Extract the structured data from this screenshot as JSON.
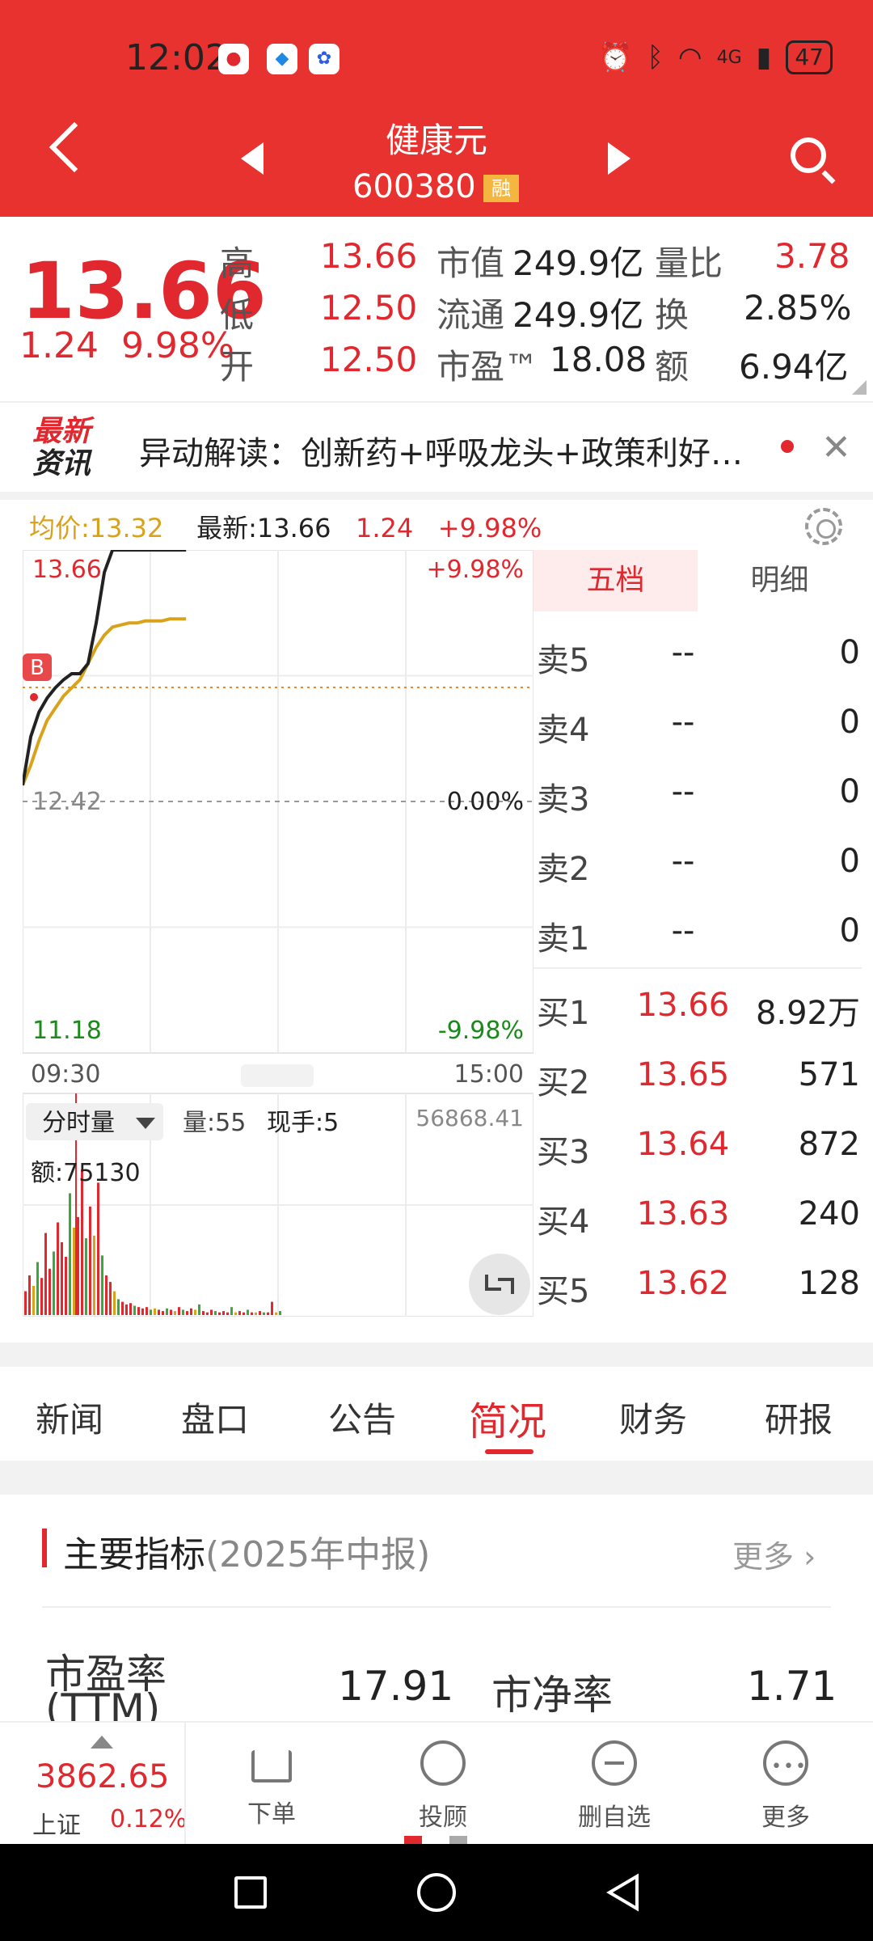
{
  "status_bar": {
    "time": "12:02",
    "battery": "47",
    "network": "4G"
  },
  "header": {
    "stock_name": "健康元",
    "stock_code": "600380",
    "margin_badge": "融"
  },
  "quote": {
    "price": "13.66",
    "change": "1.24",
    "change_pct": "9.98%",
    "rows": [
      {
        "l1": "高",
        "v1": "13.66",
        "l2": "市值",
        "v2": "249.9亿",
        "l3": "量比",
        "v3": "3.78"
      },
      {
        "l1": "低",
        "v1": "12.50",
        "l2": "流通",
        "v2": "249.9亿",
        "l3": "换",
        "v3": "2.85%"
      },
      {
        "l1": "开",
        "v1": "12.50",
        "l2": "市盈™",
        "v2": "18.08",
        "l3": "额",
        "v3": "6.94亿"
      }
    ]
  },
  "news": {
    "logo_top": "最新",
    "logo_bottom": "资讯",
    "text": "异动解读：创新药+呼吸龙头+政策利好…"
  },
  "chart_head": {
    "avg": "均价:13.32",
    "latest": "最新:13.66",
    "change": "1.24",
    "change_pct": "+9.98%"
  },
  "chart_data": {
    "type": "line",
    "title": "",
    "price_high_label": "13.66",
    "price_mid_label": "12.42",
    "price_low_label": "11.18",
    "pct_high_label": "+9.98%",
    "pct_mid_label": "0.00%",
    "pct_low_label": "-9.98%",
    "time_start": "09:30",
    "time_end": "15:00",
    "ylim": [
      11.18,
      13.66
    ],
    "prev_close": 12.42,
    "buy_marker": "B",
    "series": [
      {
        "name": "最新",
        "color": "#222222",
        "values": [
          12.5,
          12.74,
          12.86,
          12.93,
          12.98,
          13.02,
          13.05,
          13.05,
          13.1,
          13.3,
          13.55,
          13.66,
          13.66,
          13.66,
          13.66,
          13.66,
          13.66,
          13.66,
          13.66,
          13.66,
          13.66
        ]
      },
      {
        "name": "均价",
        "color": "#d9a21b",
        "values": [
          12.5,
          12.6,
          12.72,
          12.82,
          12.88,
          12.94,
          12.98,
          13.02,
          13.1,
          13.18,
          13.24,
          13.28,
          13.29,
          13.3,
          13.3,
          13.31,
          13.31,
          13.31,
          13.32,
          13.32,
          13.32
        ]
      }
    ]
  },
  "volume": {
    "selector": "分时量",
    "vol": "量:55",
    "hand": "现手:5",
    "max": "56868.41",
    "amount": "额:75130",
    "bars": [
      18,
      30,
      22,
      40,
      28,
      62,
      35,
      48,
      70,
      55,
      44,
      92,
      66,
      74,
      110,
      58,
      82,
      60,
      100,
      45,
      30,
      25,
      18,
      12,
      10,
      8,
      9,
      7,
      6,
      5,
      6,
      4,
      5,
      4,
      3,
      5,
      4,
      3,
      6,
      4,
      3,
      5,
      4,
      8,
      3,
      2,
      4,
      3,
      2,
      3,
      2,
      6,
      2,
      3,
      2,
      4,
      2,
      2,
      3,
      2,
      2,
      10,
      2,
      3
    ]
  },
  "order_book": {
    "tab_five": "五档",
    "tab_detail": "明细",
    "sells": [
      {
        "label": "卖5",
        "price": "--",
        "vol": "0"
      },
      {
        "label": "卖4",
        "price": "--",
        "vol": "0"
      },
      {
        "label": "卖3",
        "price": "--",
        "vol": "0"
      },
      {
        "label": "卖2",
        "price": "--",
        "vol": "0"
      },
      {
        "label": "卖1",
        "price": "--",
        "vol": "0"
      }
    ],
    "buys": [
      {
        "label": "买1",
        "price": "13.66",
        "vol": "8.92万"
      },
      {
        "label": "买2",
        "price": "13.65",
        "vol": "571"
      },
      {
        "label": "买3",
        "price": "13.64",
        "vol": "872"
      },
      {
        "label": "买4",
        "price": "13.63",
        "vol": "240"
      },
      {
        "label": "买5",
        "price": "13.62",
        "vol": "128"
      }
    ]
  },
  "tabs": [
    "新闻",
    "盘口",
    "公告",
    "简况",
    "财务",
    "研报"
  ],
  "active_tab": "简况",
  "indicators": {
    "title": "主要指标",
    "period": "(2025年中报)",
    "more": "更多",
    "pe_label": "市盈率",
    "pe_sub": "(TTM)",
    "pe_value": "17.91",
    "pb_label": "市净率",
    "pb_value": "1.71"
  },
  "bottom": {
    "index_value": "3862.65",
    "index_name": "上证",
    "index_pct": "0.12%",
    "order": "下单",
    "advisor": "投顾",
    "remove_watch": "删自选",
    "more": "更多"
  },
  "colors": {
    "header": "#e8322f",
    "up": "#e0282e",
    "down": "#1a8a1a",
    "avg_line": "#d9a21b"
  }
}
